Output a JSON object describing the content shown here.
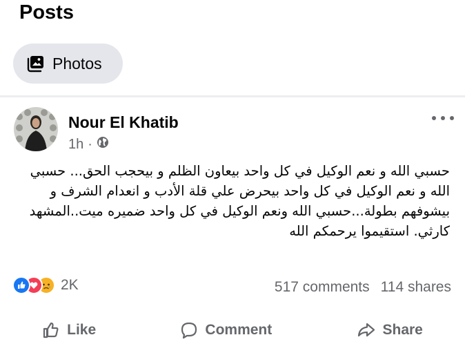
{
  "section": {
    "title": "Posts"
  },
  "filter": {
    "label": "Photos",
    "icon": "photos-icon"
  },
  "post": {
    "author": "Nour El Khatib",
    "time": "1h",
    "audience_icon": "globe-icon",
    "text": "حسبي الله و نعم الوكيل في كل واحد بيعاون الظلم و بيحجب الحق... حسبي الله و نعم الوكيل في كل واحد بيحرض علي قلة الأدب و انعدام الشرف و بيشوفهم بطولة...حسبي الله ونعم الوكيل في كل واحد ضميره ميت..المشهد كارثي. استقيموا يرحمكم الله",
    "reactions": {
      "count": "2K",
      "types": [
        "like",
        "love",
        "sad"
      ],
      "colors": {
        "like": "#1877f2",
        "love": "#f33e58",
        "sad": "#f7b125"
      }
    },
    "comments": "517 comments",
    "shares": "114 shares"
  },
  "actions": {
    "like": "Like",
    "comment": "Comment",
    "share": "Share"
  }
}
